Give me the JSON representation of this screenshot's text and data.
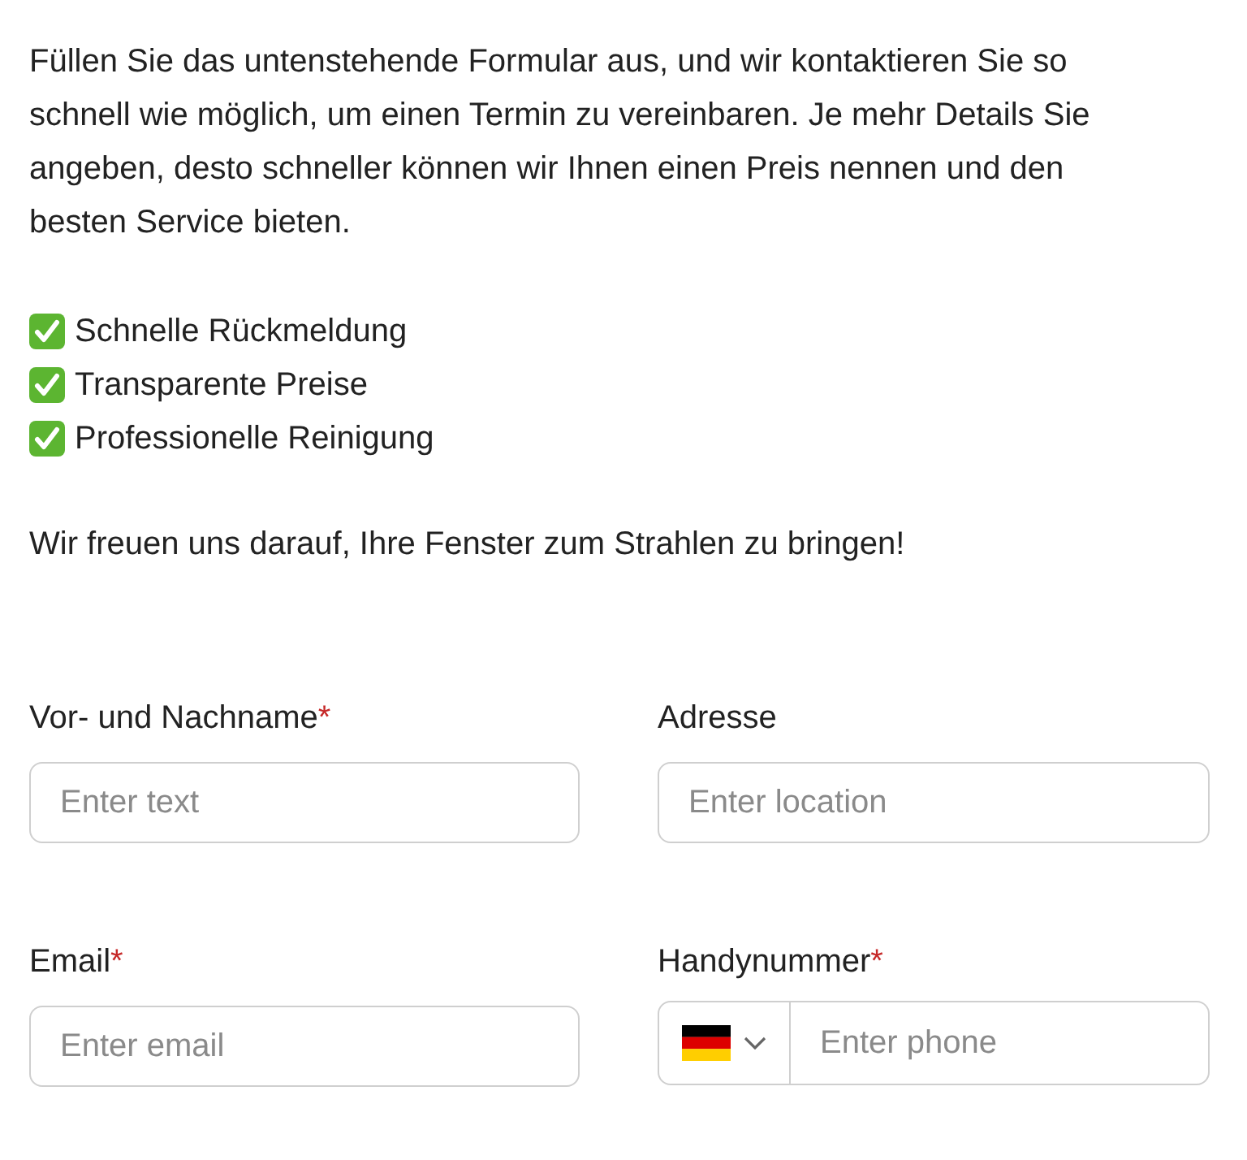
{
  "intro": "Füllen Sie das untenstehende Formular aus, und wir kontaktieren Sie so schnell wie möglich, um einen Termin zu vereinbaren. Je mehr Details Sie angeben, desto schneller können wir Ihnen einen Preis nennen und den besten Service bieten.",
  "benefits": [
    "Schnelle Rückmeldung",
    "Transparente Preise",
    "Professionelle Reinigung"
  ],
  "closing": "Wir freuen uns darauf, Ihre Fenster zum Strahlen zu bringen!",
  "fields": [
    {
      "kind": "text",
      "label": "Vor- und Nachname",
      "required_mark": "*",
      "placeholder": "Enter text"
    },
    {
      "kind": "text",
      "label": "Adresse",
      "placeholder": "Enter location"
    },
    {
      "kind": "text",
      "label": "Email",
      "required_mark": "*",
      "placeholder": "Enter email"
    },
    {
      "kind": "phone",
      "label": "Handynummer",
      "required_mark": "*",
      "placeholder": "Enter phone"
    }
  ]
}
